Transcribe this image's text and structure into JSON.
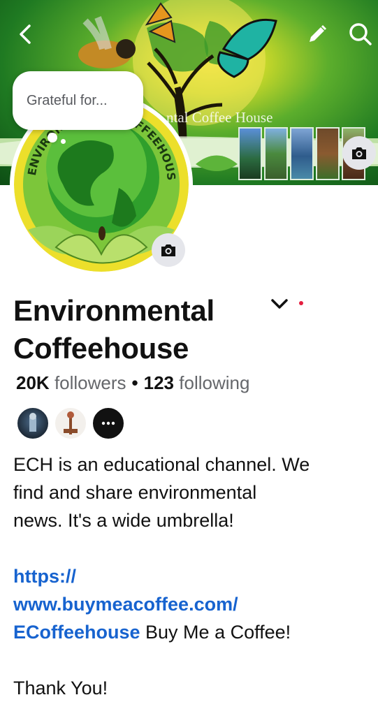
{
  "cover": {
    "caption": "ntal Coffee House"
  },
  "status_bubble": {
    "text": "Grateful for..."
  },
  "profile": {
    "name_line1": "Environmental",
    "name_line2": "Coffeehouse",
    "logo_text": "ENVIRONMENTAL COFFEEHOUSE"
  },
  "stats": {
    "followers_count": "20K",
    "followers_label": "followers",
    "separator": "•",
    "following_count": "123",
    "following_label": "following"
  },
  "bio": {
    "line1": "ECH is an educational channel. We",
    "line2": "find and share environmental",
    "line3": "news. It's a wide umbrella!",
    "link_line1": "https://",
    "link_line2": "www.buymeacoffee.com/",
    "link_line3": "ECoffeehouse",
    "link_suffix": " Buy Me a Coffee!",
    "closing": "Thank You!"
  },
  "icons": {
    "back": "chevron-left-icon",
    "edit": "pencil-icon",
    "search": "search-icon",
    "camera": "camera-icon",
    "more": "more-dots-icon",
    "dropdown": "chevron-down-icon"
  },
  "colors": {
    "link": "#1763cf",
    "notification_dot": "#e41e3f",
    "secondary_text": "#65676b"
  }
}
